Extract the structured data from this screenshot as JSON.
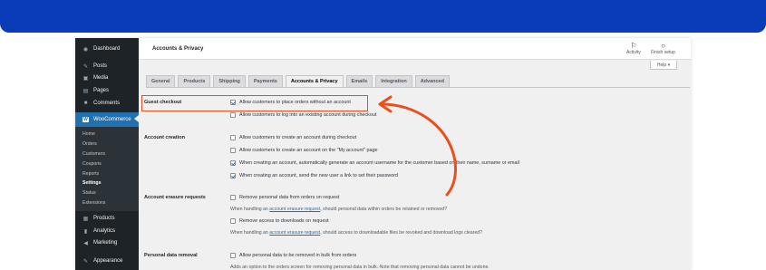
{
  "sidebar": {
    "items": [
      {
        "icon": "dashboard-icon",
        "glyph": "◉",
        "label": "Dashboard"
      },
      {
        "icon": "posts-icon",
        "glyph": "✎",
        "label": "Posts"
      },
      {
        "icon": "media-icon",
        "glyph": "▣",
        "label": "Media"
      },
      {
        "icon": "pages-icon",
        "glyph": "▤",
        "label": "Pages"
      },
      {
        "icon": "comments-icon",
        "glyph": "■",
        "label": "Comments"
      },
      {
        "icon": "woocommerce-icon",
        "glyph": "W",
        "label": "WooCommerce"
      }
    ],
    "submenu": [
      "Home",
      "Orders",
      "Customers",
      "Coupons",
      "Reports",
      "Settings",
      "Status",
      "Extensions"
    ],
    "items_after": [
      {
        "icon": "products-icon",
        "glyph": "▦",
        "label": "Products"
      },
      {
        "icon": "analytics-icon",
        "glyph": "▮",
        "label": "Analytics"
      },
      {
        "icon": "marketing-icon",
        "glyph": "◀",
        "label": "Marketing"
      },
      {
        "icon": "appearance-icon",
        "glyph": "✎",
        "label": "Appearance"
      }
    ]
  },
  "header": {
    "title": "Accounts & Privacy",
    "activity_label": "Activity",
    "finish_setup_label": "Finish setup",
    "help_label": "Help ▾"
  },
  "tabs": [
    "General",
    "Products",
    "Shipping",
    "Payments",
    "Accounts & Privacy",
    "Emails",
    "Integration",
    "Advanced"
  ],
  "sections": {
    "guest_checkout": {
      "label": "Guest checkout",
      "options": [
        {
          "text": "Allow customers to place orders without an account",
          "checked": true
        },
        {
          "text": "Allow customers to log into an existing account during checkout",
          "checked": false
        }
      ]
    },
    "account_creation": {
      "label": "Account creation",
      "options": [
        {
          "text": "Allow customers to create an account during checkout",
          "checked": false
        },
        {
          "text": "Allow customers to create an account on the \"My account\" page",
          "checked": false
        },
        {
          "text": "When creating an account, automatically generate an account username for the customer based on their name, surname or email",
          "checked": true
        },
        {
          "text": "When creating an account, send the new user a link to set their password",
          "checked": true
        }
      ]
    },
    "account_erasure": {
      "label": "Account erasure requests",
      "opt1": "Remove personal data from orders on request",
      "desc1_pre": "When handling an ",
      "desc1_link": "account erasure request",
      "desc1_post": ", should personal data within orders be retained or removed?",
      "opt2": "Remove access to downloads on request",
      "desc2_pre": "When handling an ",
      "desc2_link": "account erasure request",
      "desc2_post": ", should access to downloadable files be revoked and download logs cleared?"
    },
    "personal_data_removal": {
      "label": "Personal data removal",
      "opt1": "Allow personal data to be removed in bulk from orders",
      "desc1": "Adds an option to the orders screen for removing personal data in bulk. Note that removing personal data cannot be undone."
    }
  },
  "colors": {
    "banner": "#0a3bb8",
    "highlight": "#e8501d",
    "accent": "#2271b1"
  }
}
